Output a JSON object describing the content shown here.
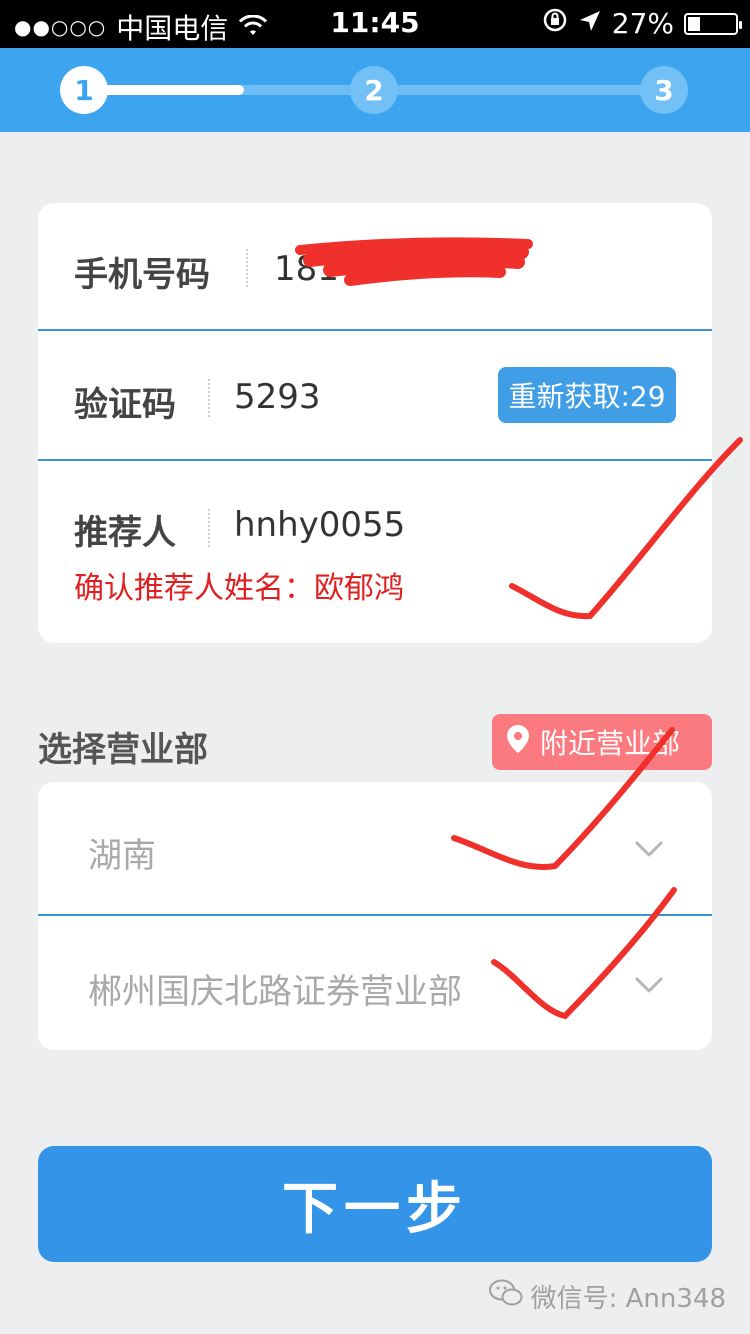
{
  "status_bar": {
    "signal": "●●○○○",
    "carrier": "中国电信",
    "time": "11:45",
    "battery_percent": "27%",
    "battery_level": 0.27
  },
  "steps": {
    "items": [
      "1",
      "2",
      "3"
    ],
    "current": 1
  },
  "form": {
    "phone_label": "手机号码",
    "phone_value": "181",
    "code_label": "验证码",
    "code_value": "5293",
    "resend_label": "重新获取:29",
    "referrer_label": "推荐人",
    "referrer_value": "hnhy0055",
    "referrer_confirm": "确认推荐人姓名：欧郁鸿"
  },
  "branch": {
    "section_title": "选择营业部",
    "nearby_label": "附近营业部",
    "province": "湖南",
    "office": "郴州国庆北路证券营业部"
  },
  "actions": {
    "next_label": "下一步"
  },
  "watermark": {
    "text": "微信号: Ann348"
  },
  "colors": {
    "header_blue": "#3da5f0",
    "button_blue": "#3495e8",
    "red_text": "#e02020",
    "nearby_pink": "#fb7a80",
    "scribble_red": "#f0302a"
  },
  "icons": {
    "location": "location-pin-icon",
    "chevron": "chevron-down-icon",
    "wifi": "wifi-icon",
    "battery": "battery-icon",
    "wechat": "wechat-icon"
  }
}
